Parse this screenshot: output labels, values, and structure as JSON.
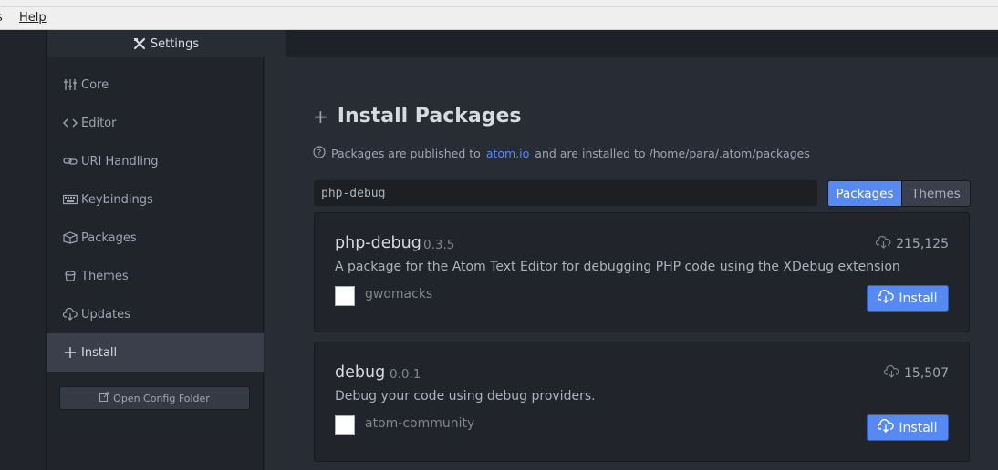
{
  "menubar": {
    "items": [
      "es",
      "Help"
    ]
  },
  "tab": {
    "title": "Settings"
  },
  "sidebar": {
    "items": [
      {
        "label": "Core",
        "icon": "sliders-icon"
      },
      {
        "label": "Editor",
        "icon": "code-icon"
      },
      {
        "label": "URI Handling",
        "icon": "link-icon"
      },
      {
        "label": "Keybindings",
        "icon": "keyboard-icon"
      },
      {
        "label": "Packages",
        "icon": "package-icon"
      },
      {
        "label": "Themes",
        "icon": "paintcan-icon"
      },
      {
        "label": "Updates",
        "icon": "cloud-download-icon"
      },
      {
        "label": "Install",
        "icon": "plus-icon",
        "active": true
      }
    ],
    "config_button": "Open Config Folder"
  },
  "main": {
    "header": "Install Packages",
    "info": {
      "prefix": "Packages are published to",
      "link": "atom.io",
      "suffix": "and are installed to /home/para/.atom/packages"
    },
    "search": {
      "value": "php-debug"
    },
    "toggle": {
      "packages": "Packages",
      "themes": "Themes",
      "selected": "Packages"
    },
    "results": [
      {
        "name": "php-debug",
        "version": "0.3.5",
        "downloads": "215,125",
        "description": "A package for the Atom Text Editor for debugging PHP code using the XDebug extension",
        "author": "gwomacks",
        "install_label": "Install"
      },
      {
        "name": "debug",
        "version": "0.0.1",
        "downloads": "15,507",
        "description": "Debug your code using debug providers.",
        "author": "atom-community",
        "install_label": "Install"
      }
    ]
  },
  "colors": {
    "accent": "#568af2",
    "panel_bg": "#282c34",
    "sidebar_bg": "#21252b",
    "text": "#d7dae0",
    "muted_text": "#9da5b4"
  }
}
